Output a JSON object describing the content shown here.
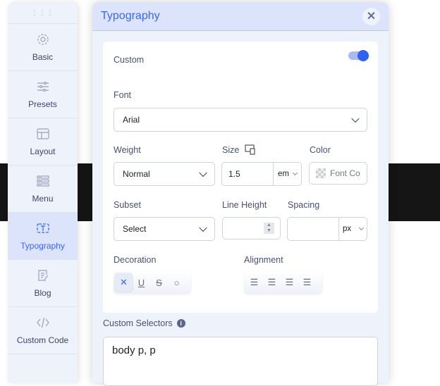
{
  "sidebar": {
    "items": [
      {
        "label": "Basic",
        "icon": "gear-icon"
      },
      {
        "label": "Presets",
        "icon": "sliders-icon"
      },
      {
        "label": "Layout",
        "icon": "layout-icon"
      },
      {
        "label": "Menu",
        "icon": "menu-icon"
      },
      {
        "label": "Typography",
        "icon": "text-icon",
        "active": true
      },
      {
        "label": "Blog",
        "icon": "edit-icon"
      },
      {
        "label": "Custom Code",
        "icon": "code-icon"
      }
    ]
  },
  "panel": {
    "title": "Typography",
    "custom_label": "Custom",
    "custom_enabled": true,
    "font": {
      "label": "Font",
      "value": "Arial"
    },
    "weight": {
      "label": "Weight",
      "value": "Normal"
    },
    "size": {
      "label": "Size",
      "value": "1.5",
      "unit": "em"
    },
    "color": {
      "label": "Color",
      "placeholder": "Font Co"
    },
    "subset": {
      "label": "Subset",
      "value": "Select"
    },
    "line_height": {
      "label": "Line Height",
      "value": ""
    },
    "spacing": {
      "label": "Spacing",
      "value": "",
      "unit": "px"
    },
    "decoration": {
      "label": "Decoration",
      "options": [
        "none",
        "underline",
        "strikethrough",
        "overline"
      ],
      "selected": "none"
    },
    "alignment": {
      "label": "Alignment",
      "options": [
        "left",
        "center",
        "right",
        "justify"
      ]
    },
    "custom_selectors": {
      "label": "Custom Selectors",
      "value": "body p, p"
    }
  },
  "colors": {
    "accent": "#3b66f5",
    "header": "#dce4fb"
  }
}
